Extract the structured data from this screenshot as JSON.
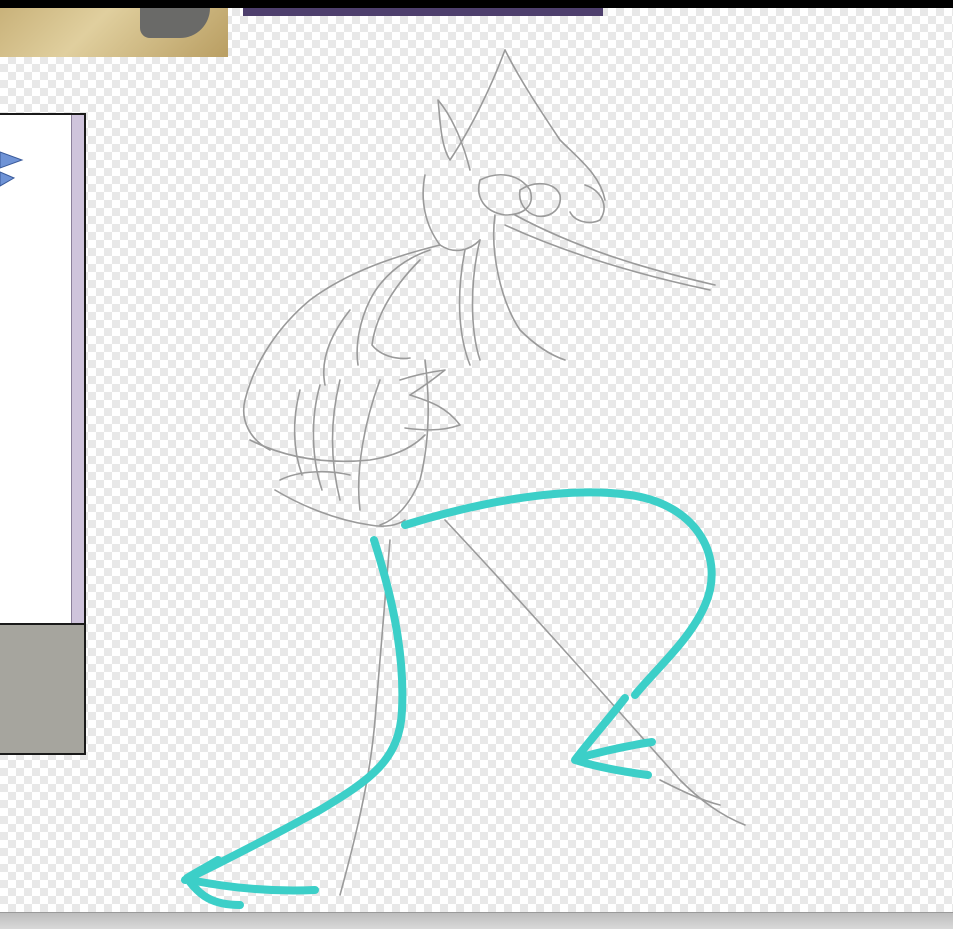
{
  "canvas": {
    "transparency_pattern": "checkerboard",
    "sketch_stroke_color": "#9a9a9a",
    "ink_stroke_color": "#3ccfc8"
  },
  "reference_images": [
    "reference-photo",
    "reference-image",
    "reference-panel"
  ],
  "icons": [
    "beak-icon"
  ]
}
